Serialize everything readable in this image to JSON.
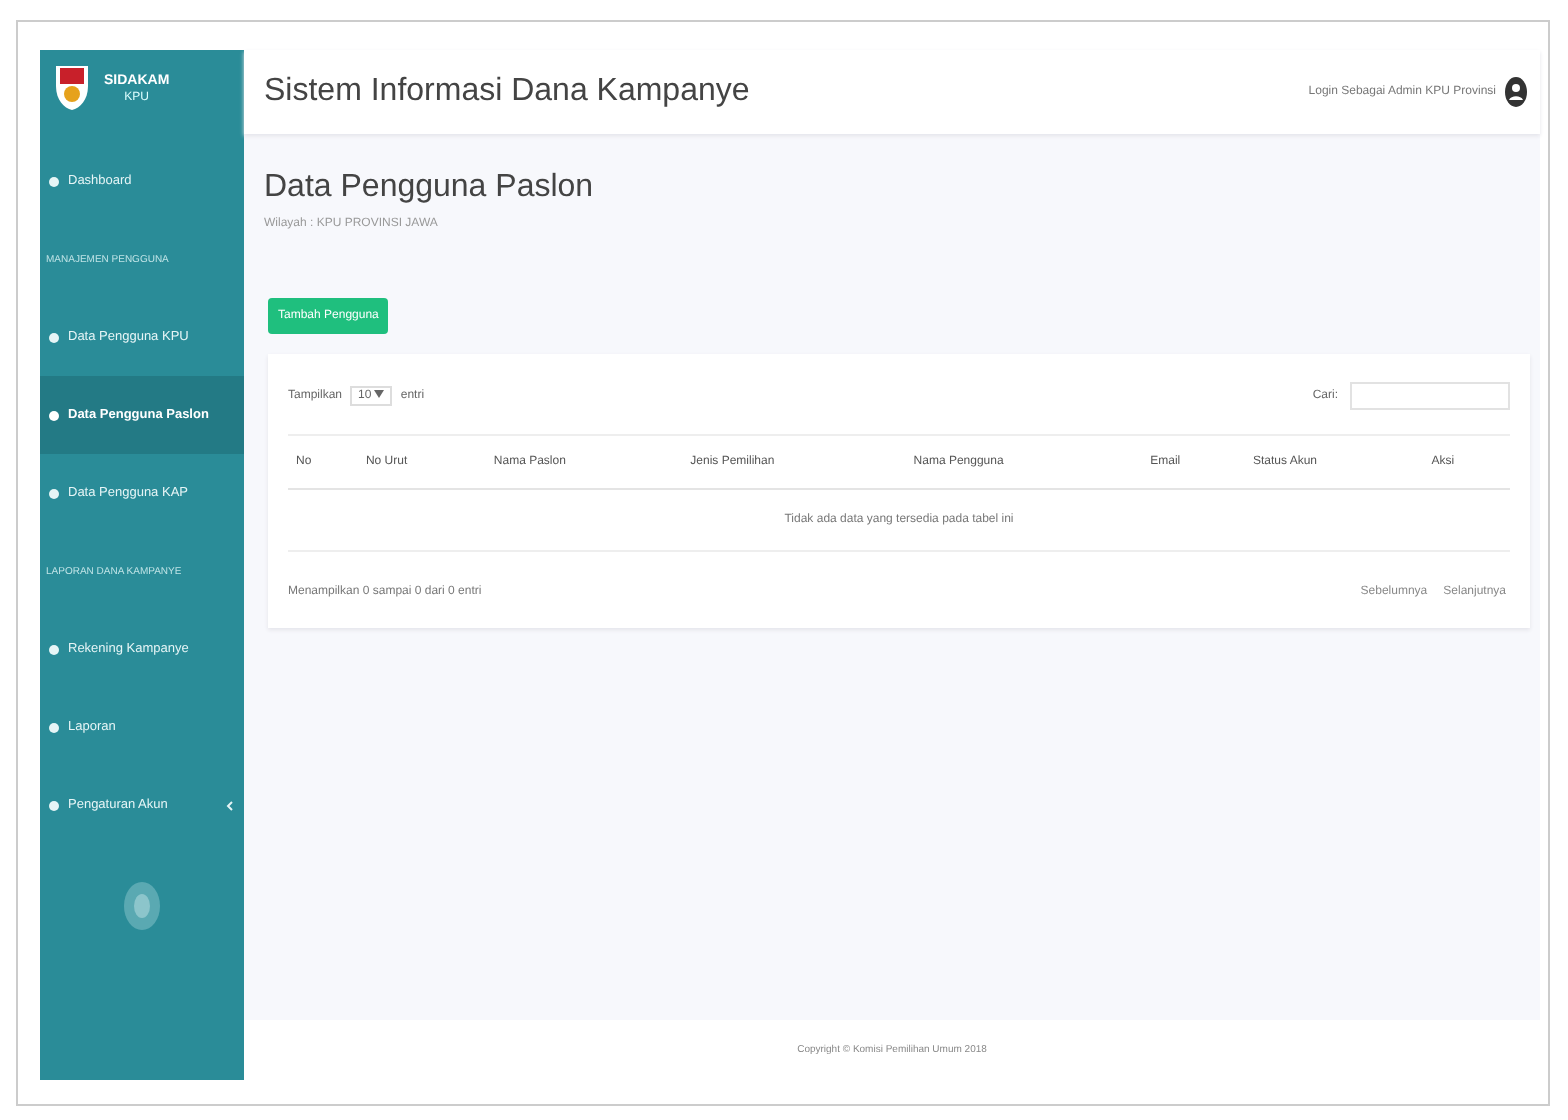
{
  "sidebar": {
    "logo": {
      "title": "SIDAKAM",
      "subtitle": "KPU"
    },
    "items": [
      {
        "kind": "link",
        "label": "Dashboard",
        "selected": false
      },
      {
        "kind": "heading",
        "label": "MANAJEMEN PENGGUNA"
      },
      {
        "kind": "link",
        "label": "Data Pengguna KPU",
        "selected": false
      },
      {
        "kind": "link",
        "label": "Data Pengguna Paslon",
        "selected": true
      },
      {
        "kind": "link",
        "label": "Data Pengguna KAP",
        "selected": false
      },
      {
        "kind": "heading",
        "label": "LAPORAN DANA KAMPANYE"
      },
      {
        "kind": "link",
        "label": "Rekening Kampanye",
        "selected": false
      },
      {
        "kind": "link",
        "label": "Laporan",
        "selected": false
      },
      {
        "kind": "menu",
        "label": "Pengaturan Akun",
        "selected": false
      }
    ]
  },
  "header": {
    "title": "Sistem Informasi Dana Kampanye",
    "user": "Login Sebagai Admin KPU Provinsi"
  },
  "page": {
    "title": "Data Pengguna Paslon",
    "subtitle": "Wilayah : KPU PROVINSI JAWA"
  },
  "add_button": "Tambah Pengguna",
  "table": {
    "length_label": "Tampilkan",
    "length_value": "10",
    "length_suffix": "entri",
    "search_label": "Cari:",
    "columns": [
      "No",
      "No Urut",
      "Nama Paslon",
      "Jenis Pemilihan",
      "Nama Pengguna",
      "Email",
      "Status Akun",
      "Aksi"
    ],
    "empty": "Tidak ada data yang tersedia pada tabel ini",
    "info": "Menampilkan 0 sampai 0 dari 0 entri",
    "pager": [
      "Sebelumnya",
      "Selanjutnya"
    ]
  },
  "footer": "Copyright © Komisi Pemilihan Umum 2018"
}
